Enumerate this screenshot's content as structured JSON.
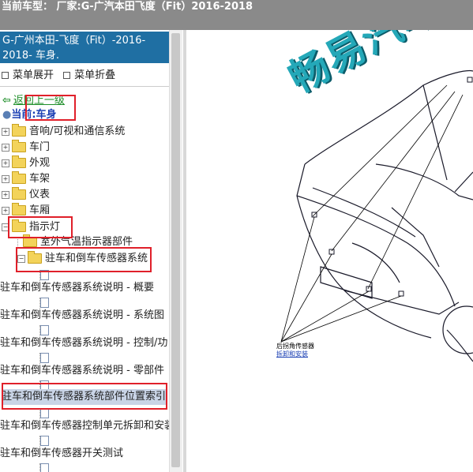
{
  "window": {
    "title": "当前车型：  厂家:G-广汽本田飞度（Fit）2016-2018"
  },
  "sidebar": {
    "header": "G-广州本田-飞度（Fit）-2016-2018- 车身.",
    "menu_expand": "菜单展开",
    "menu_collapse": "菜单折叠",
    "back_link": "返回上一级",
    "current_label": "当前:车身",
    "tree": [
      "音响/可视和通信系统",
      "车门",
      "外观",
      "车架",
      "仪表",
      "车厢",
      "指示灯",
      "室外气温指示器部件",
      "驻车和倒车传感器系统"
    ],
    "docs": [
      "驻车和倒车传感器系统说明 - 概要",
      "驻车和倒车传感器系统说明 - 系统图",
      "驻车和倒车传感器系统说明 - 控制/功",
      "驻车和倒车传感器系统说明 - 零部件",
      "驻车和倒车传感器系统部件位置索引",
      "驻车和倒车传感器控制单元拆卸和安装",
      "驻车和倒车传感器开关测试"
    ]
  },
  "diagram": {
    "watermark": "畅易汽车维",
    "caption_title": "后拐角传感器",
    "caption_link": "拆卸和安装"
  }
}
